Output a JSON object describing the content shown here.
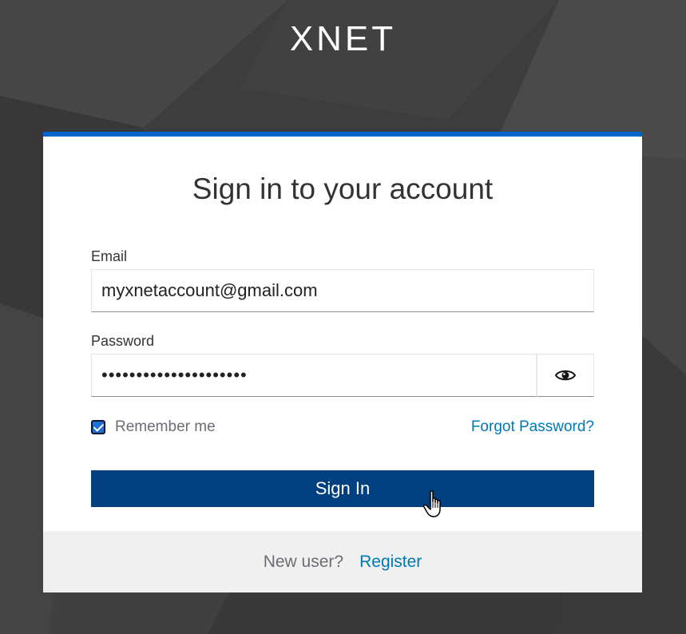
{
  "brand": {
    "name": "XNET"
  },
  "login": {
    "title": "Sign in to your account",
    "email_label": "Email",
    "email_value": "myxnetaccount@gmail.com",
    "password_label": "Password",
    "password_value": "•••••••••••••••••••••",
    "remember_label": "Remember me",
    "remember_checked": true,
    "forgot_label": "Forgot Password?",
    "signin_label": "Sign In"
  },
  "footer": {
    "question": "New user?",
    "register_label": "Register"
  },
  "icons": {
    "show_password": "eye-icon",
    "checkbox": "checkbox-checked-icon",
    "cursor": "hand-pointer-cursor-icon"
  },
  "colors": {
    "accent": "#0066cc",
    "button": "#004080",
    "link": "#0078b4",
    "background": "#3e3e3e"
  }
}
